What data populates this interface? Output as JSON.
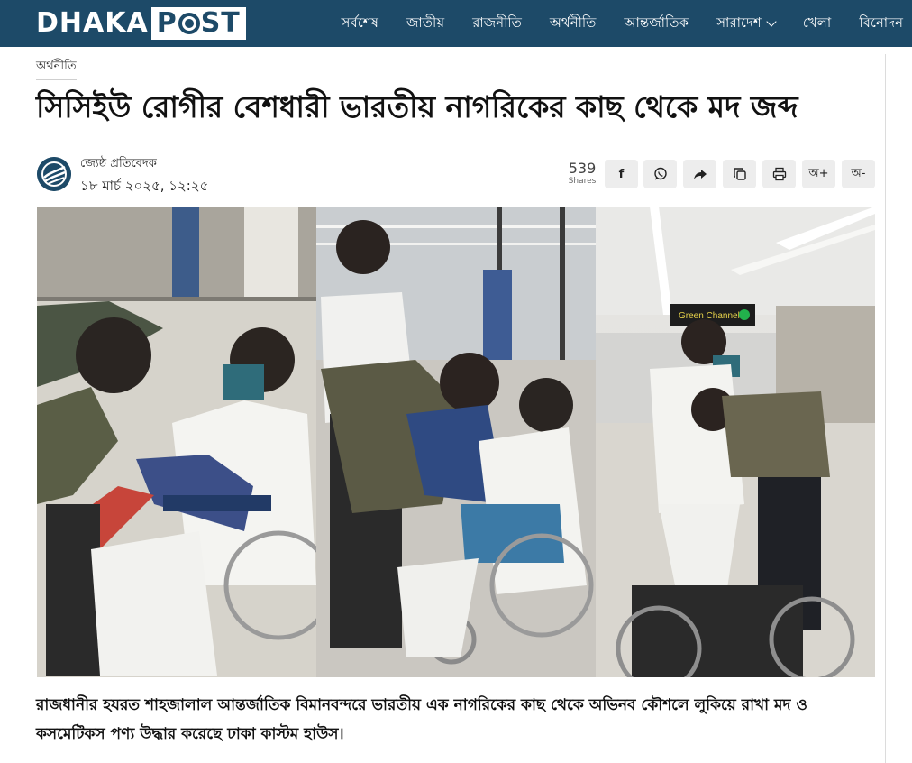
{
  "header": {
    "logo_left": "DHAKA",
    "logo_right_p": "P",
    "logo_right_st": "ST",
    "nav": [
      {
        "label": "সর্বশেষ"
      },
      {
        "label": "জাতীয়"
      },
      {
        "label": "রাজনীতি"
      },
      {
        "label": "অর্থনীতি"
      },
      {
        "label": "আন্তর্জাতিক"
      },
      {
        "label": "সারাদেশ"
      },
      {
        "label": "খেলা"
      },
      {
        "label": "বিনোদন"
      }
    ]
  },
  "article": {
    "category": "অর্থনীতি",
    "title": "সিসিইউ রোগীর বেশধারী ভারতীয় নাগরিকের কাছ থেকে মদ জব্দ",
    "author": "জ্যেষ্ঠ প্রতিবেদক",
    "date": "১৮ মার্চ ২০২৫, ১২:২৫",
    "lead": "রাজধানীর হযরত শাহজালাল আন্তর্জাতিক বিমানবন্দরে ভারতীয় এক নাগরিকের কাছ থেকে অভিনব কৌশলে লুকিয়ে রাখা মদ ও কসমেটিকস পণ্য উদ্ধার করেছে ঢাকা কাস্টম হাউস।"
  },
  "share": {
    "count": "539",
    "count_label": "Shares",
    "facebook": "f",
    "font_increase": "অ+",
    "font_decrease": "অ-",
    "icons": [
      "facebook-icon",
      "whatsapp-icon",
      "share-icon",
      "copy-icon",
      "print-icon"
    ]
  },
  "photos": {
    "sign_text": "Green Channel"
  },
  "colors": {
    "header_bg": "#1d4a68",
    "button_bg": "#ededed"
  }
}
